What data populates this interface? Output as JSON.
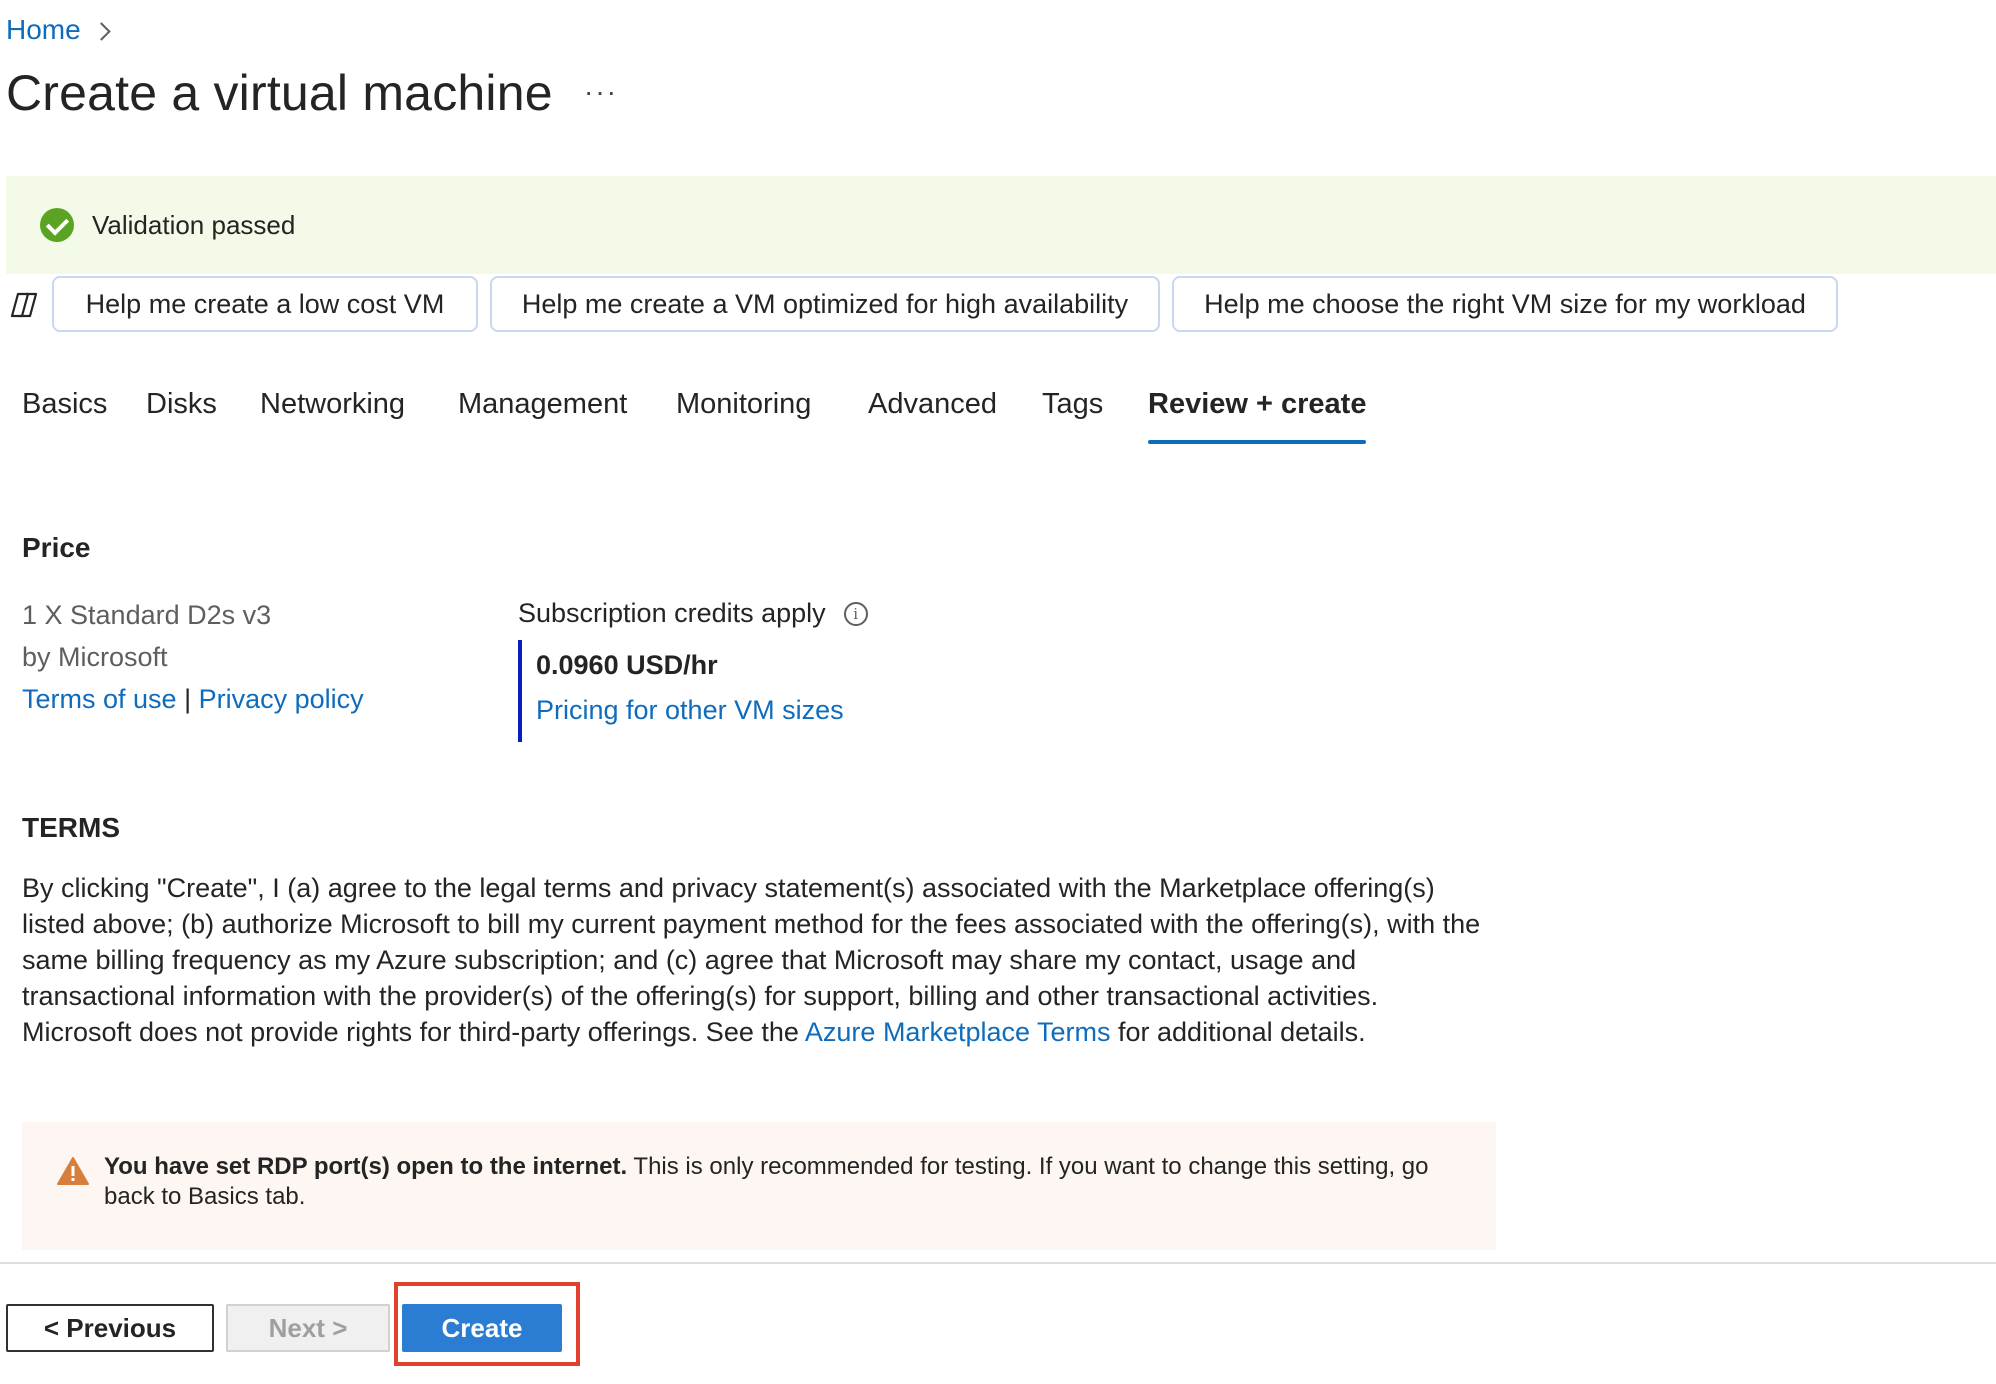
{
  "breadcrumb": {
    "home": "Home"
  },
  "page": {
    "title": "Create a virtual machine",
    "more": "···"
  },
  "banner": {
    "text": "Validation passed"
  },
  "copilot_chips": [
    "Help me create a low cost VM",
    "Help me create a VM optimized for high availability",
    "Help me choose the right VM size for my workload"
  ],
  "tabs": [
    "Basics",
    "Disks",
    "Networking",
    "Management",
    "Monitoring",
    "Advanced",
    "Tags",
    "Review + create"
  ],
  "active_tab": "Review + create",
  "price": {
    "heading": "Price",
    "sku": "1 X Standard D2s v3",
    "vendor": "by Microsoft",
    "terms_link": "Terms of use",
    "separator": "|",
    "privacy_link": "Privacy policy",
    "credits_label": "Subscription credits apply",
    "amount": "0.0960 USD/hr",
    "pricing_link": "Pricing for other VM sizes"
  },
  "terms": {
    "heading": "TERMS",
    "body_before": "By clicking \"Create\", I (a) agree to the legal terms and privacy statement(s) associated with the Marketplace offering(s) listed above; (b) authorize Microsoft to bill my current payment method for the fees associated with the offering(s), with the same billing frequency as my Azure subscription; and (c) agree that Microsoft may share my contact, usage and transactional information with the provider(s) of the offering(s) for support, billing and other transactional activities. Microsoft does not provide rights for third-party offerings. See the ",
    "link": "Azure Marketplace Terms",
    "body_after": " for additional details."
  },
  "warning": {
    "bold": "You have set RDP port(s) open to the internet.",
    "text": "  This is only recommended for testing.  If you want to change this setting, go back to Basics tab."
  },
  "footer": {
    "previous": "< Previous",
    "next": "Next >",
    "create": "Create"
  },
  "colors": {
    "accent": "#0f6cbd",
    "success": "#5ba423",
    "warning": "#d67f3c",
    "highlight": "#e0412f"
  }
}
